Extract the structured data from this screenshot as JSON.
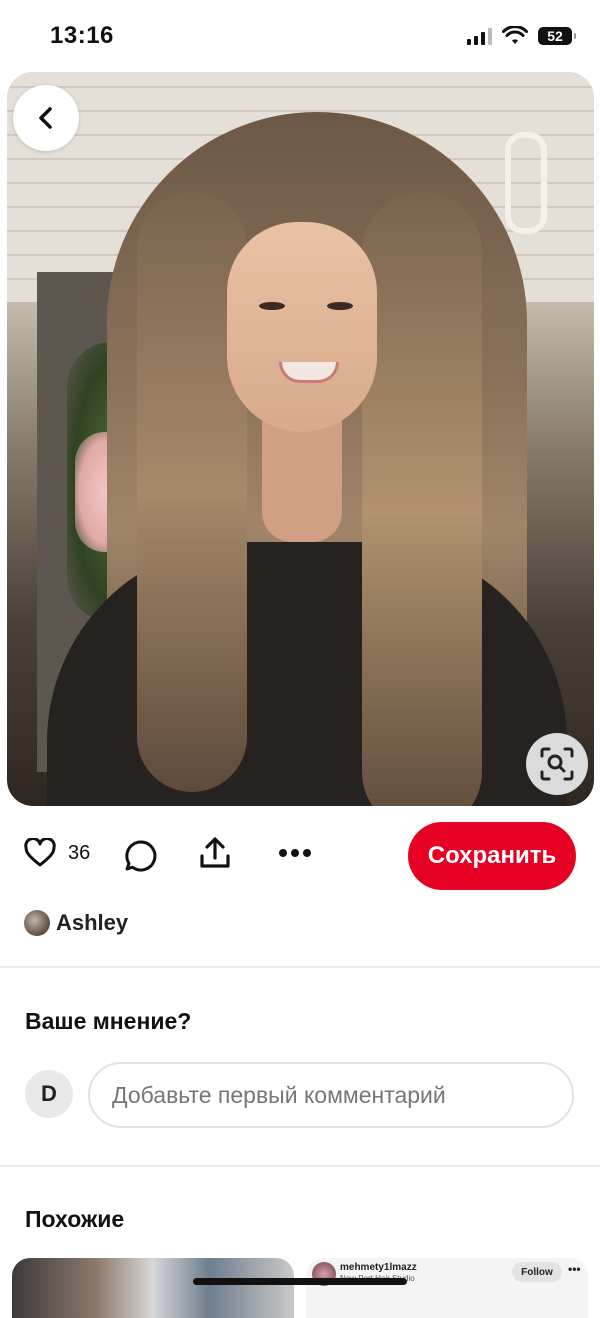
{
  "status_bar": {
    "time": "13:16",
    "battery": "52"
  },
  "pin": {
    "image_alt": "Woman with long layered brunette hair with highlights",
    "likes_count": "36",
    "save_label": "Сохранить",
    "author_name": "Ashley"
  },
  "comments": {
    "title": "Ваше мнение?",
    "user_initial": "D",
    "input_placeholder": "Добавьте первый комментарий"
  },
  "similar": {
    "title": "Похожие",
    "items": [
      {
        "kind": "image"
      },
      {
        "username": "mehmety1lmazz",
        "subtitle": "New Port Hair Studio",
        "follow_label": "Follow",
        "more": "•••"
      }
    ]
  },
  "colors": {
    "accent": "#e60023",
    "text": "#111111",
    "placeholder": "#767676"
  },
  "icons": [
    "chevron-left-icon",
    "visual-search-icon",
    "heart-icon",
    "comment-icon",
    "share-icon",
    "more-icon",
    "wifi-icon",
    "signal-icon",
    "battery-icon"
  ]
}
